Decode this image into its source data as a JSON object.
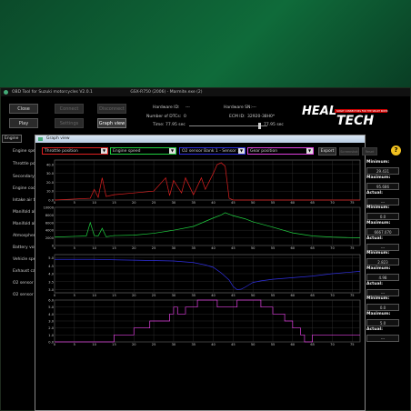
{
  "main": {
    "title": "OBD Tool for Suzuki motorcycles V2.0.1",
    "subtitle": "GSX-R750 (2006) - Marmite.exe (2)",
    "buttons": {
      "close": "Close",
      "connect": "Connect",
      "disconnect": "Disconnect",
      "play": "Play",
      "settings": "Settings",
      "graph": "Graph view"
    },
    "hardware_id_label": "Hardware ID:",
    "hardware_id_value": "---",
    "hardware_sn_label": "Hardware SN:",
    "hardware_sn_value": "---",
    "dtc_label": "Number of DTCs:",
    "dtc_value": "0",
    "ecm_label": "ECM ID:",
    "ecm_value": "32920-38H0*",
    "time_label": "Time: 77.95 sec",
    "time_end": "77.95 sec",
    "tab_engine": "Engine",
    "sidebar": [
      "Engine speed",
      "Throttle position",
      "Secondary throttle",
      "Engine coolant",
      "Intake air temp",
      "Manifold abs.",
      "Manifold abs.",
      "Atmospheric",
      "Battery voltage",
      "Vehicle speed",
      "Exhaust camshaft",
      "O2 sensor",
      "O2 sensor"
    ],
    "logo_top": "HEAL",
    "logo_bottom": "TECH",
    "logo_tag": "SMART CONNECTORS FOR THE SMART RIDER"
  },
  "graph": {
    "title": "Graph view",
    "selectors": [
      {
        "label": "Throttle position",
        "color": "#e02020"
      },
      {
        "label": "Engine speed",
        "color": "#20d040"
      },
      {
        "label": "O2 sensor Bank 1 - Sensor 1",
        "color": "#3030e0"
      },
      {
        "label": "Gear position",
        "color": "#e040e0"
      }
    ],
    "export_label": "Export",
    "disabled_btn1": "Screenshot",
    "disabled_btn2": "Reset",
    "help_icon_label": "?",
    "panels": [
      {
        "minimum_label": "Minimum:",
        "minimum": "29.431",
        "maximum_label": "Maximum:",
        "maximum": "95.686",
        "actual_label": "Actual:",
        "actual": "---"
      },
      {
        "minimum_label": "Minimum:",
        "minimum": "0.0",
        "maximum_label": "Maximum:",
        "maximum": "6667.070",
        "actual_label": "Actual:",
        "actual": "---"
      },
      {
        "minimum_label": "Minimum:",
        "minimum": "2.823",
        "maximum_label": "Maximum:",
        "maximum": "4.98",
        "actual_label": "Actual:",
        "actual": "---"
      },
      {
        "minimum_label": "Minimum:",
        "minimum": "0.0",
        "maximum_label": "Maximum:",
        "maximum": "5.0",
        "actual_label": "Actual:",
        "actual": "---"
      }
    ]
  },
  "chart_data": [
    {
      "type": "line",
      "series": [
        {
          "name": "Throttle position",
          "x": [
            0,
            9,
            10,
            11,
            12,
            13,
            15,
            20,
            25,
            28,
            29,
            30,
            32,
            33,
            35,
            37,
            38,
            40,
            41,
            42,
            43,
            44,
            45,
            50,
            60,
            70,
            77
          ],
          "values": [
            0,
            2,
            12,
            3,
            25,
            4,
            6,
            8,
            10,
            25,
            5,
            22,
            8,
            25,
            6,
            25,
            12,
            30,
            40,
            42,
            38,
            2,
            0,
            0,
            0,
            0,
            0
          ]
        }
      ],
      "ylim": [
        0,
        45
      ],
      "yticks": [
        0,
        10,
        20,
        30,
        40
      ],
      "xlim": [
        0,
        77
      ]
    },
    {
      "type": "line",
      "series": [
        {
          "name": "Engine speed",
          "x": [
            0,
            5,
            8,
            9,
            10,
            11,
            12,
            13,
            15,
            20,
            25,
            30,
            35,
            40,
            42,
            43,
            44,
            45,
            48,
            50,
            55,
            60,
            65,
            70,
            77
          ],
          "values": [
            2200,
            2400,
            2500,
            6000,
            2600,
            2500,
            4500,
            2300,
            2600,
            2700,
            3200,
            4000,
            5000,
            7200,
            8000,
            8600,
            8200,
            7800,
            7000,
            6200,
            4800,
            3300,
            2500,
            2200,
            2000
          ]
        }
      ],
      "ylim": [
        0,
        10000
      ],
      "yticks": [
        0,
        2000,
        4000,
        6000,
        8000,
        10000
      ],
      "xlim": [
        0,
        77
      ]
    },
    {
      "type": "line",
      "series": [
        {
          "name": "O2 sensor Bank 1 - Sensor 1",
          "x": [
            0,
            10,
            20,
            30,
            35,
            38,
            40,
            42,
            44,
            45,
            46,
            47,
            48,
            49,
            50,
            52,
            55,
            60,
            65,
            70,
            77
          ],
          "values": [
            4.9,
            4.9,
            4.85,
            4.8,
            4.7,
            4.55,
            4.4,
            4.05,
            3.6,
            3.2,
            3.0,
            3.02,
            3.15,
            3.3,
            3.45,
            3.55,
            3.65,
            3.75,
            3.85,
            4.0,
            4.15
          ]
        }
      ],
      "ylim": [
        2.8,
        5.2
      ],
      "yticks": [
        3.0,
        3.5,
        4.0,
        4.5,
        5.0
      ],
      "xlim": [
        0,
        77
      ]
    },
    {
      "type": "line",
      "series": [
        {
          "name": "Gear position",
          "x": [
            0,
            15,
            15,
            20,
            20,
            24,
            24,
            29,
            29,
            30,
            30,
            31,
            31,
            33,
            33,
            36,
            36,
            41,
            41,
            46,
            46,
            52,
            52,
            55,
            55,
            58,
            58,
            60,
            60,
            62,
            62,
            63,
            63,
            65,
            65,
            77
          ],
          "values": [
            0,
            0,
            1,
            1,
            2,
            2,
            3,
            3,
            4,
            4,
            5,
            5,
            4,
            4,
            5,
            5,
            6,
            6,
            5,
            5,
            6,
            6,
            5,
            5,
            4,
            4,
            3,
            3,
            2,
            2,
            1,
            1,
            0,
            0,
            1,
            1
          ]
        }
      ],
      "ylim": [
        0,
        6
      ],
      "yticks": [
        0,
        1.0,
        2.0,
        3.0,
        4.0,
        5.0,
        6.0
      ],
      "xlim": [
        0,
        77
      ]
    }
  ],
  "x_axis_ticks": [
    0,
    5,
    10,
    15,
    20,
    25,
    30,
    35,
    40,
    45,
    50,
    55,
    60,
    65,
    70,
    75
  ]
}
